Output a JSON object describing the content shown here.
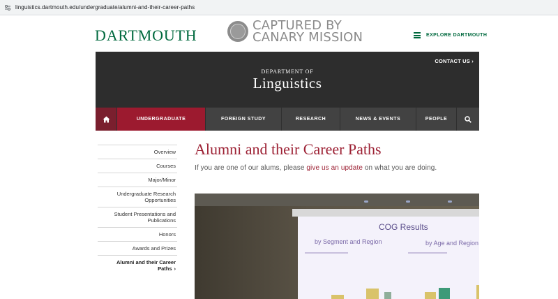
{
  "browser": {
    "url": "linguistics.dartmouth.edu/undergraduate/alumni-and-their-career-paths"
  },
  "header": {
    "logo": "DARTMOUTH",
    "watermark_line1": "CAPTURED BY",
    "watermark_line2": "CANARY MISSION",
    "explore": "EXPLORE DARTMOUTH"
  },
  "banner": {
    "contact": "CONTACT US",
    "dept_prefix": "DEPARTMENT OF",
    "dept_name": "Linguistics"
  },
  "nav": {
    "items": [
      "UNDERGRADUATE",
      "FOREIGN STUDY",
      "RESEARCH",
      "NEWS & EVENTS",
      "PEOPLE"
    ]
  },
  "sidebar": {
    "items": [
      "Overview",
      "Courses",
      "Major/Minor",
      "Undergraduate Research Opportunities",
      "Student Presentations and Publications",
      "Honors",
      "Awards and Prizes",
      "Alumni and their Career Paths"
    ],
    "active_index": 7
  },
  "main": {
    "title": "Alumni and their Career Paths",
    "intro_before": "If you are one of our alums, please ",
    "intro_link": "give us an update",
    "intro_after": " on what you are doing."
  },
  "slide": {
    "title": "COG Results",
    "left_heading": "by Segment and Region",
    "right_heading": "by Age and Region"
  },
  "colors": {
    "dartmouth_green": "#00693e",
    "crimson": "#9d2235",
    "banner_dark": "#2d2d2d",
    "nav_gray": "#424242"
  },
  "icons": [
    "browser-site-icon",
    "canary-mission-seal",
    "menu-icon",
    "home-icon",
    "search-icon",
    "chevron-right-icon"
  ]
}
